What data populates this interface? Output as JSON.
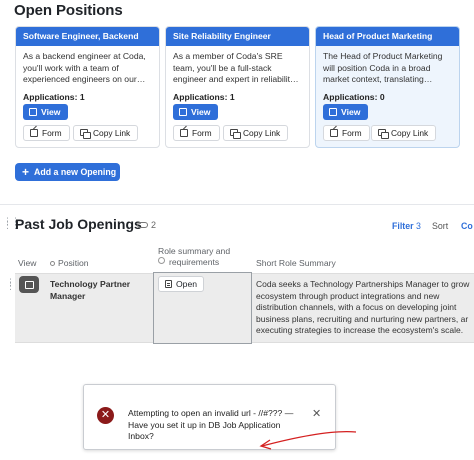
{
  "open_positions": {
    "title": "Open Positions",
    "cards": [
      {
        "header": "Software Engineer, Backend",
        "description": "As a backend engineer at Coda, you'll work with a team of experienced engineers on our…",
        "applications_label": "Applications: 1",
        "view_label": "View",
        "form_label": "Form",
        "copy_link_label": "Copy Link"
      },
      {
        "header": "Site Reliability Engineer",
        "description": "As a member of Coda's SRE team, you'll be a full-stack engineer and expert in reliabilit…",
        "applications_label": "Applications: 1",
        "view_label": "View",
        "form_label": "Form",
        "copy_link_label": "Copy Link"
      },
      {
        "header": "Head of Product Marketing",
        "description": "The Head of Product Marketing will position Coda in a broad market context, translating…",
        "applications_label": "Applications: 0",
        "view_label": "View",
        "form_label": "Form",
        "copy_link_label": "Copy Link"
      }
    ],
    "add_button_label": "Add a new Opening"
  },
  "past_openings": {
    "title": "Past Job Openings",
    "link_count": "2",
    "filter_label": "Filter",
    "filter_count": "3",
    "sort_label": "Sort",
    "more_label": "Co",
    "columns": {
      "view": "View",
      "position": "Position",
      "role_summary": "Role summary and requirements",
      "short_summary": "Short Role Summary"
    },
    "rows": [
      {
        "position": "Technology Partner Manager",
        "open_label": "Open",
        "short_summary_lines": [
          "Coda seeks a Technology Partnerships Manager to grow",
          "ecosystem through product integrations and new",
          "distribution channels, with a focus on developing joint",
          "business plans, recruiting and nurturing new partners, ar",
          "executing strategies to increase the ecosystem's scale."
        ]
      }
    ]
  },
  "toast": {
    "message": "Attempting to open an invalid url - //#??? — Have you set it up in DB Job Application Inbox?",
    "close_glyph": "✕",
    "error_glyph": "✕"
  },
  "colors": {
    "accent": "#2f6fd9",
    "error": "#8b1a1a",
    "annotation": "#d42020"
  }
}
